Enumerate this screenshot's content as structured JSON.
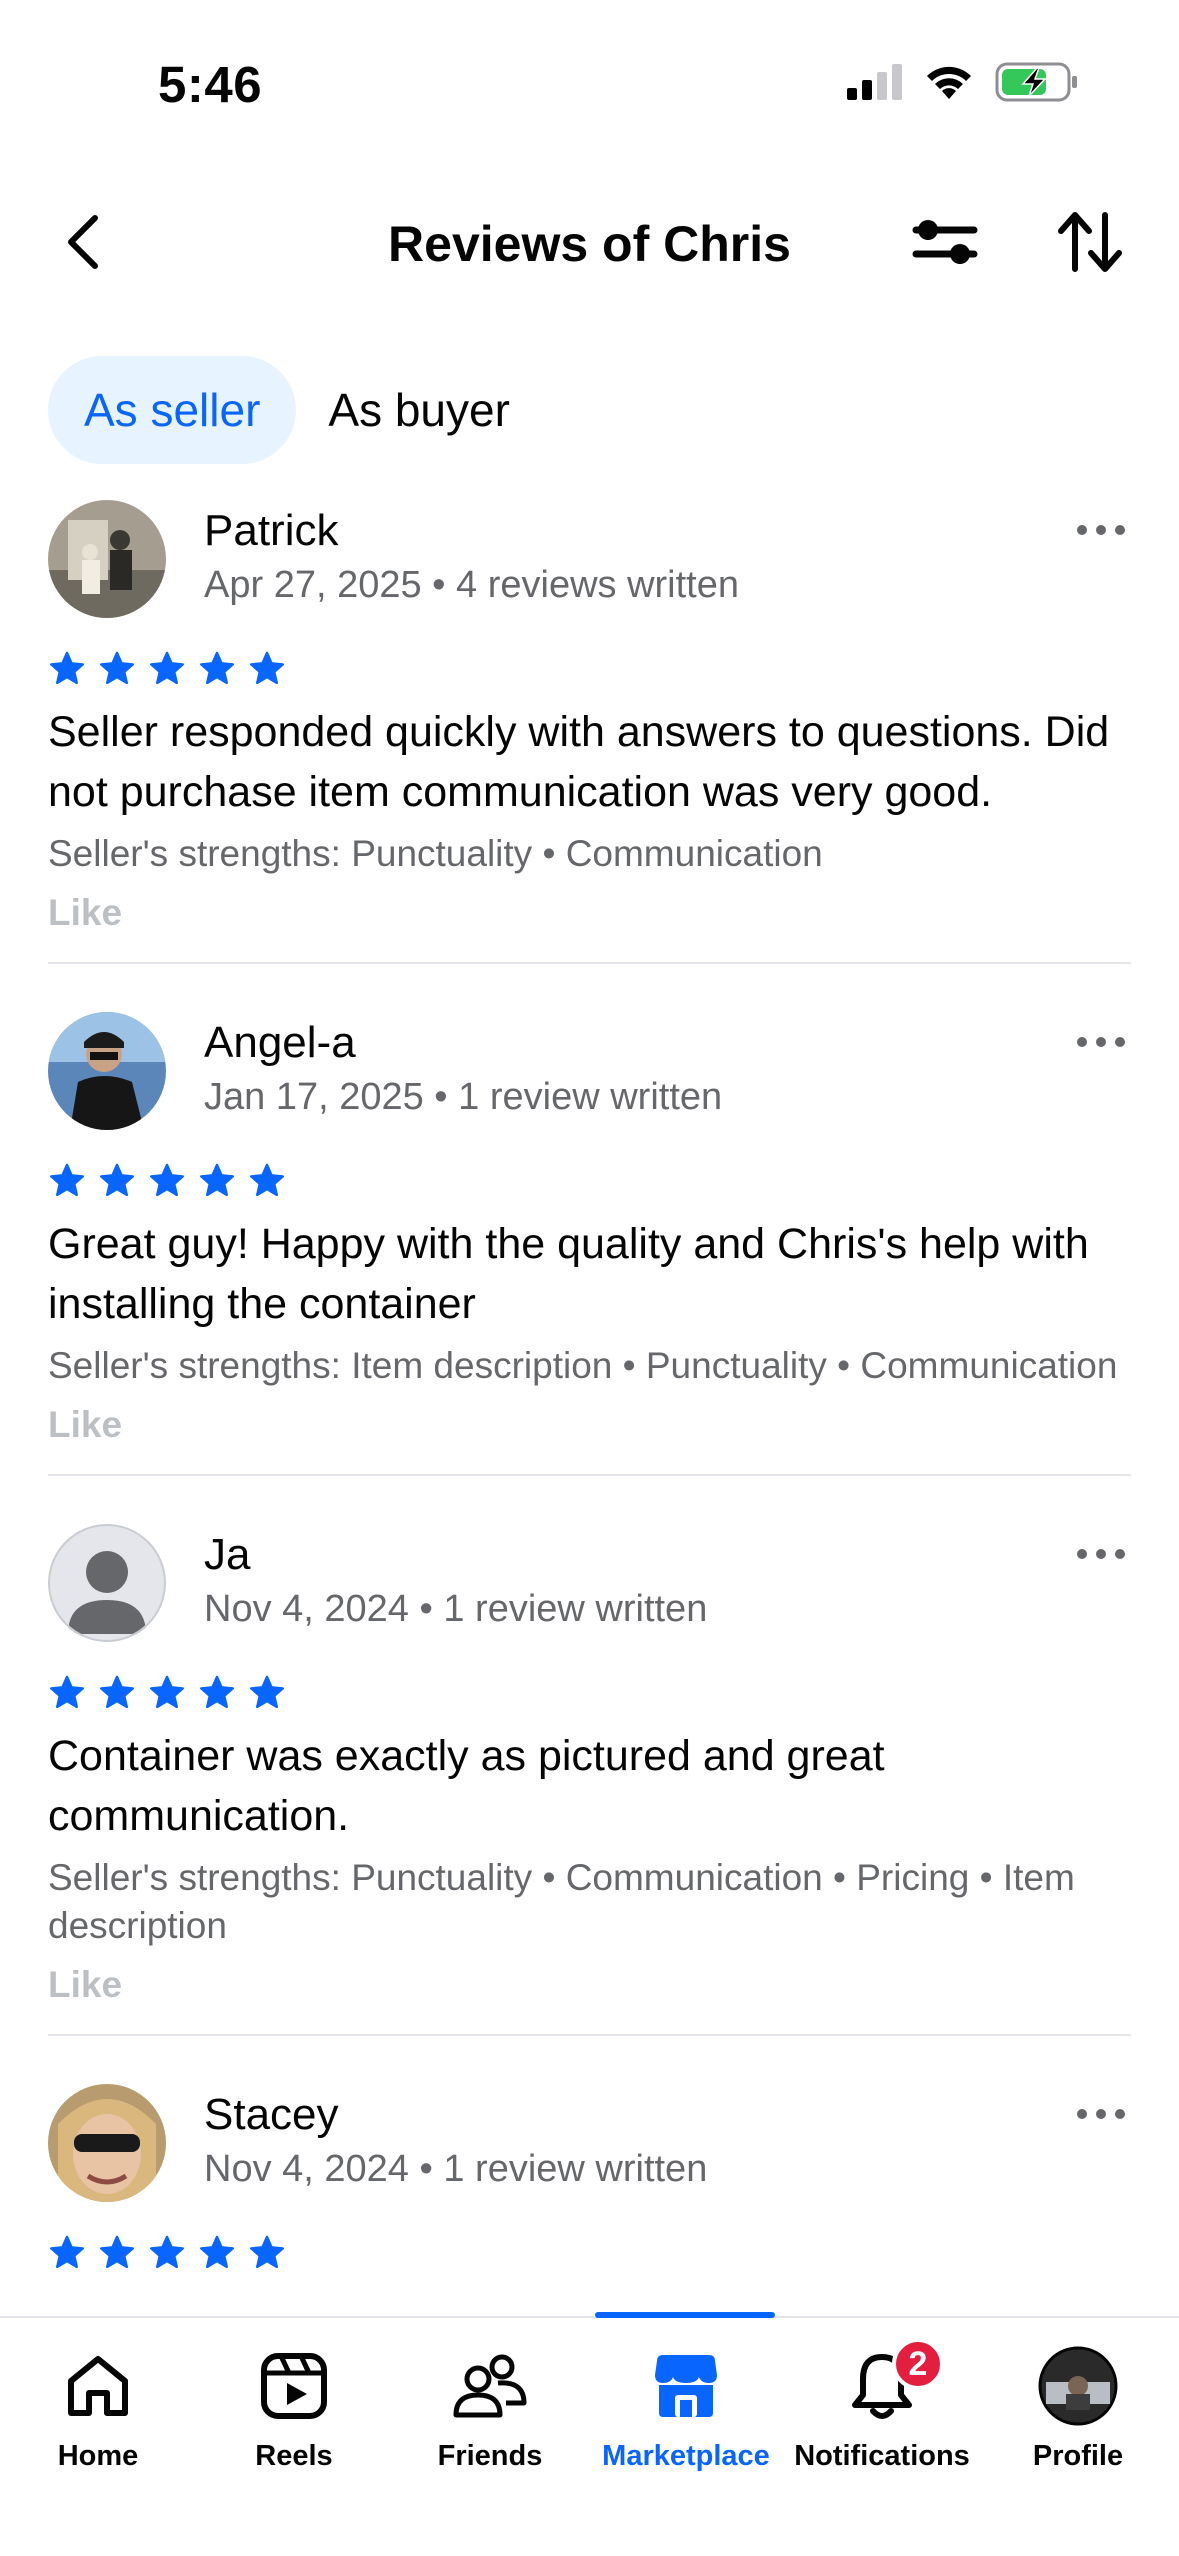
{
  "status_bar": {
    "time": "5:46"
  },
  "header": {
    "title": "Reviews of Chris"
  },
  "tabs": [
    {
      "label": "As seller",
      "active": true
    },
    {
      "label": "As buyer",
      "active": false
    }
  ],
  "colors": {
    "accent": "#0866ff",
    "star": "#0866ff",
    "badge": "#e41e3f",
    "secondary_text": "#65676b"
  },
  "reviews": [
    {
      "name": "Patrick",
      "date": "Apr 27, 2025",
      "reviews_written": "4 reviews written",
      "rating": 5,
      "text": "Seller responded quickly with answers to questions. Did not purchase item communication was very good.",
      "strengths": "Seller's strengths: Punctuality • Communication",
      "like_label": "Like"
    },
    {
      "name": "Angel-a",
      "date": "Jan 17, 2025",
      "reviews_written": "1 review written",
      "rating": 5,
      "text": "Great guy! Happy with the quality and Chris's help with installing the container",
      "strengths": "Seller's strengths: Item description • Punctuality • Communication",
      "like_label": "Like"
    },
    {
      "name": "Ja",
      "date": "Nov 4, 2024",
      "reviews_written": "1 review written",
      "rating": 5,
      "text": "Container was exactly as pictured and great communication.",
      "strengths": "Seller's strengths: Punctuality • Communication • Pricing • Item description",
      "like_label": "Like"
    },
    {
      "name": "Stacey",
      "date": "Nov 4, 2024",
      "reviews_written": "1 review written",
      "rating": 5,
      "text": "",
      "strengths": "",
      "like_label": ""
    }
  ],
  "bottom_nav": {
    "items": [
      {
        "label": "Home",
        "icon": "home-icon"
      },
      {
        "label": "Reels",
        "icon": "reels-icon"
      },
      {
        "label": "Friends",
        "icon": "friends-icon"
      },
      {
        "label": "Marketplace",
        "icon": "marketplace-icon",
        "active": true
      },
      {
        "label": "Notifications",
        "icon": "bell-icon",
        "badge": "2"
      },
      {
        "label": "Profile",
        "icon": "profile-avatar"
      }
    ]
  }
}
